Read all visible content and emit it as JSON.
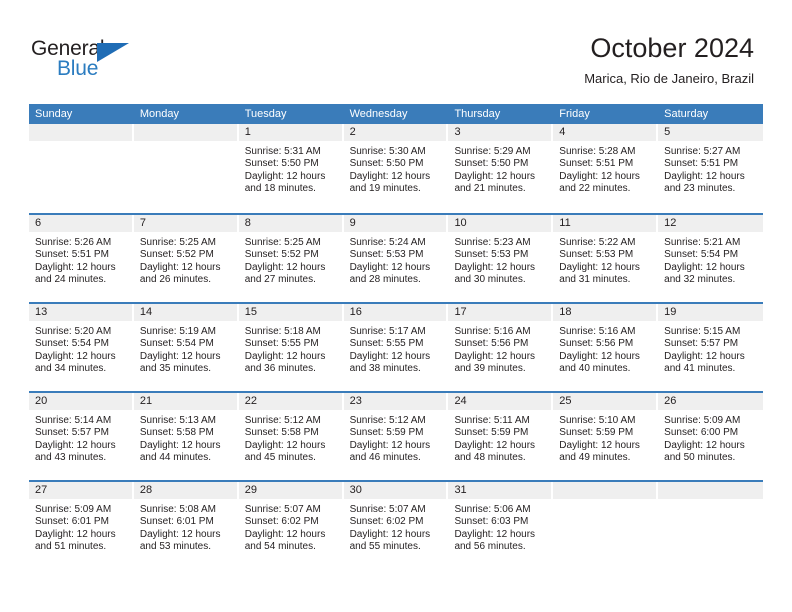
{
  "brand": {
    "name_part1": "General",
    "name_part2": "Blue",
    "triangle_color": "#1f6cb5",
    "blue_color": "#2b7cc0"
  },
  "header": {
    "title": "October 2024",
    "subtitle": "Marica, Rio de Janeiro, Brazil",
    "accent_color": "#3a7cba",
    "band_color": "#efefef"
  },
  "calendar": {
    "day_names": [
      "Sunday",
      "Monday",
      "Tuesday",
      "Wednesday",
      "Thursday",
      "Friday",
      "Saturday"
    ],
    "weeks": [
      [
        {
          "day": "",
          "lines": []
        },
        {
          "day": "",
          "lines": []
        },
        {
          "day": "1",
          "lines": [
            "Sunrise: 5:31 AM",
            "Sunset: 5:50 PM",
            "Daylight: 12 hours",
            "and 18 minutes."
          ]
        },
        {
          "day": "2",
          "lines": [
            "Sunrise: 5:30 AM",
            "Sunset: 5:50 PM",
            "Daylight: 12 hours",
            "and 19 minutes."
          ]
        },
        {
          "day": "3",
          "lines": [
            "Sunrise: 5:29 AM",
            "Sunset: 5:50 PM",
            "Daylight: 12 hours",
            "and 21 minutes."
          ]
        },
        {
          "day": "4",
          "lines": [
            "Sunrise: 5:28 AM",
            "Sunset: 5:51 PM",
            "Daylight: 12 hours",
            "and 22 minutes."
          ]
        },
        {
          "day": "5",
          "lines": [
            "Sunrise: 5:27 AM",
            "Sunset: 5:51 PM",
            "Daylight: 12 hours",
            "and 23 minutes."
          ]
        }
      ],
      [
        {
          "day": "6",
          "lines": [
            "Sunrise: 5:26 AM",
            "Sunset: 5:51 PM",
            "Daylight: 12 hours",
            "and 24 minutes."
          ]
        },
        {
          "day": "7",
          "lines": [
            "Sunrise: 5:25 AM",
            "Sunset: 5:52 PM",
            "Daylight: 12 hours",
            "and 26 minutes."
          ]
        },
        {
          "day": "8",
          "lines": [
            "Sunrise: 5:25 AM",
            "Sunset: 5:52 PM",
            "Daylight: 12 hours",
            "and 27 minutes."
          ]
        },
        {
          "day": "9",
          "lines": [
            "Sunrise: 5:24 AM",
            "Sunset: 5:53 PM",
            "Daylight: 12 hours",
            "and 28 minutes."
          ]
        },
        {
          "day": "10",
          "lines": [
            "Sunrise: 5:23 AM",
            "Sunset: 5:53 PM",
            "Daylight: 12 hours",
            "and 30 minutes."
          ]
        },
        {
          "day": "11",
          "lines": [
            "Sunrise: 5:22 AM",
            "Sunset: 5:53 PM",
            "Daylight: 12 hours",
            "and 31 minutes."
          ]
        },
        {
          "day": "12",
          "lines": [
            "Sunrise: 5:21 AM",
            "Sunset: 5:54 PM",
            "Daylight: 12 hours",
            "and 32 minutes."
          ]
        }
      ],
      [
        {
          "day": "13",
          "lines": [
            "Sunrise: 5:20 AM",
            "Sunset: 5:54 PM",
            "Daylight: 12 hours",
            "and 34 minutes."
          ]
        },
        {
          "day": "14",
          "lines": [
            "Sunrise: 5:19 AM",
            "Sunset: 5:54 PM",
            "Daylight: 12 hours",
            "and 35 minutes."
          ]
        },
        {
          "day": "15",
          "lines": [
            "Sunrise: 5:18 AM",
            "Sunset: 5:55 PM",
            "Daylight: 12 hours",
            "and 36 minutes."
          ]
        },
        {
          "day": "16",
          "lines": [
            "Sunrise: 5:17 AM",
            "Sunset: 5:55 PM",
            "Daylight: 12 hours",
            "and 38 minutes."
          ]
        },
        {
          "day": "17",
          "lines": [
            "Sunrise: 5:16 AM",
            "Sunset: 5:56 PM",
            "Daylight: 12 hours",
            "and 39 minutes."
          ]
        },
        {
          "day": "18",
          "lines": [
            "Sunrise: 5:16 AM",
            "Sunset: 5:56 PM",
            "Daylight: 12 hours",
            "and 40 minutes."
          ]
        },
        {
          "day": "19",
          "lines": [
            "Sunrise: 5:15 AM",
            "Sunset: 5:57 PM",
            "Daylight: 12 hours",
            "and 41 minutes."
          ]
        }
      ],
      [
        {
          "day": "20",
          "lines": [
            "Sunrise: 5:14 AM",
            "Sunset: 5:57 PM",
            "Daylight: 12 hours",
            "and 43 minutes."
          ]
        },
        {
          "day": "21",
          "lines": [
            "Sunrise: 5:13 AM",
            "Sunset: 5:58 PM",
            "Daylight: 12 hours",
            "and 44 minutes."
          ]
        },
        {
          "day": "22",
          "lines": [
            "Sunrise: 5:12 AM",
            "Sunset: 5:58 PM",
            "Daylight: 12 hours",
            "and 45 minutes."
          ]
        },
        {
          "day": "23",
          "lines": [
            "Sunrise: 5:12 AM",
            "Sunset: 5:59 PM",
            "Daylight: 12 hours",
            "and 46 minutes."
          ]
        },
        {
          "day": "24",
          "lines": [
            "Sunrise: 5:11 AM",
            "Sunset: 5:59 PM",
            "Daylight: 12 hours",
            "and 48 minutes."
          ]
        },
        {
          "day": "25",
          "lines": [
            "Sunrise: 5:10 AM",
            "Sunset: 5:59 PM",
            "Daylight: 12 hours",
            "and 49 minutes."
          ]
        },
        {
          "day": "26",
          "lines": [
            "Sunrise: 5:09 AM",
            "Sunset: 6:00 PM",
            "Daylight: 12 hours",
            "and 50 minutes."
          ]
        }
      ],
      [
        {
          "day": "27",
          "lines": [
            "Sunrise: 5:09 AM",
            "Sunset: 6:01 PM",
            "Daylight: 12 hours",
            "and 51 minutes."
          ]
        },
        {
          "day": "28",
          "lines": [
            "Sunrise: 5:08 AM",
            "Sunset: 6:01 PM",
            "Daylight: 12 hours",
            "and 53 minutes."
          ]
        },
        {
          "day": "29",
          "lines": [
            "Sunrise: 5:07 AM",
            "Sunset: 6:02 PM",
            "Daylight: 12 hours",
            "and 54 minutes."
          ]
        },
        {
          "day": "30",
          "lines": [
            "Sunrise: 5:07 AM",
            "Sunset: 6:02 PM",
            "Daylight: 12 hours",
            "and 55 minutes."
          ]
        },
        {
          "day": "31",
          "lines": [
            "Sunrise: 5:06 AM",
            "Sunset: 6:03 PM",
            "Daylight: 12 hours",
            "and 56 minutes."
          ]
        },
        {
          "day": "",
          "lines": []
        },
        {
          "day": "",
          "lines": []
        }
      ]
    ]
  }
}
